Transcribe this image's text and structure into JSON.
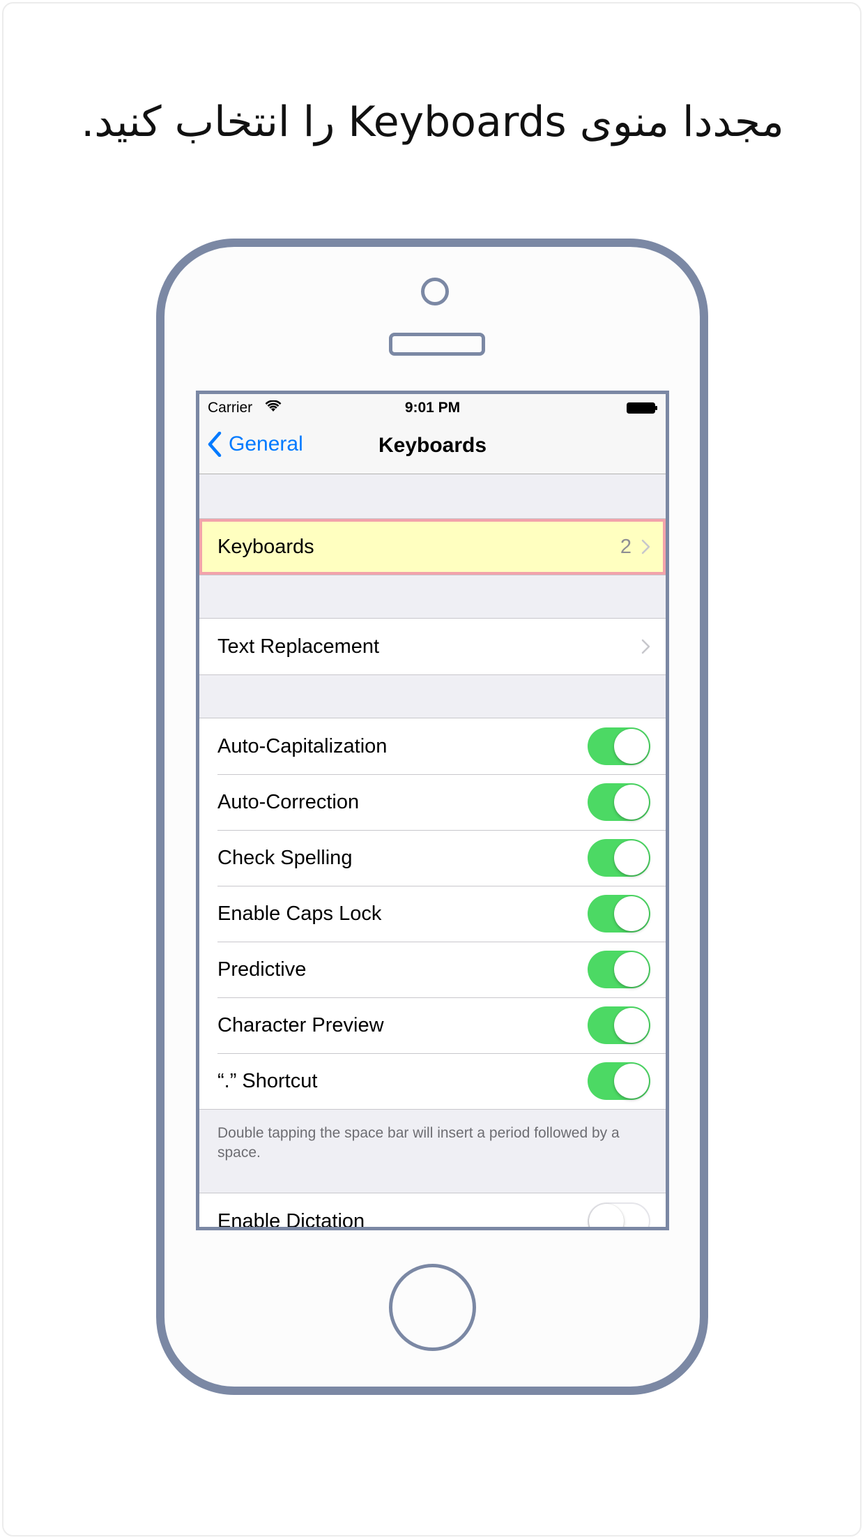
{
  "instruction": "مجددا منوی Keyboards را انتخاب کنید.",
  "status_bar": {
    "carrier": "Carrier",
    "time": "9:01 PM",
    "wifi_icon": "wifi-icon",
    "battery_icon": "battery-icon"
  },
  "nav": {
    "back_label": "General",
    "title": "Keyboards"
  },
  "keyboards_row": {
    "label": "Keyboards",
    "detail": "2"
  },
  "text_replacement_row": {
    "label": "Text Replacement"
  },
  "toggle_rows": [
    {
      "label": "Auto-Capitalization",
      "on": true
    },
    {
      "label": "Auto-Correction",
      "on": true
    },
    {
      "label": "Check Spelling",
      "on": true
    },
    {
      "label": "Enable Caps Lock",
      "on": true
    },
    {
      "label": "Predictive",
      "on": true
    },
    {
      "label": "Character Preview",
      "on": true
    },
    {
      "label": "“.” Shortcut",
      "on": true
    }
  ],
  "shortcut_note": "Double tapping the space bar will insert a period followed by a space.",
  "dictation_row": {
    "label": "Enable Dictation",
    "on": false
  },
  "colors": {
    "frame": "#7b88a4",
    "toggle_on": "#4cd964",
    "link_blue": "#007aff",
    "highlight_fill": "#ffffc0",
    "highlight_border": "#f2a3ab"
  }
}
